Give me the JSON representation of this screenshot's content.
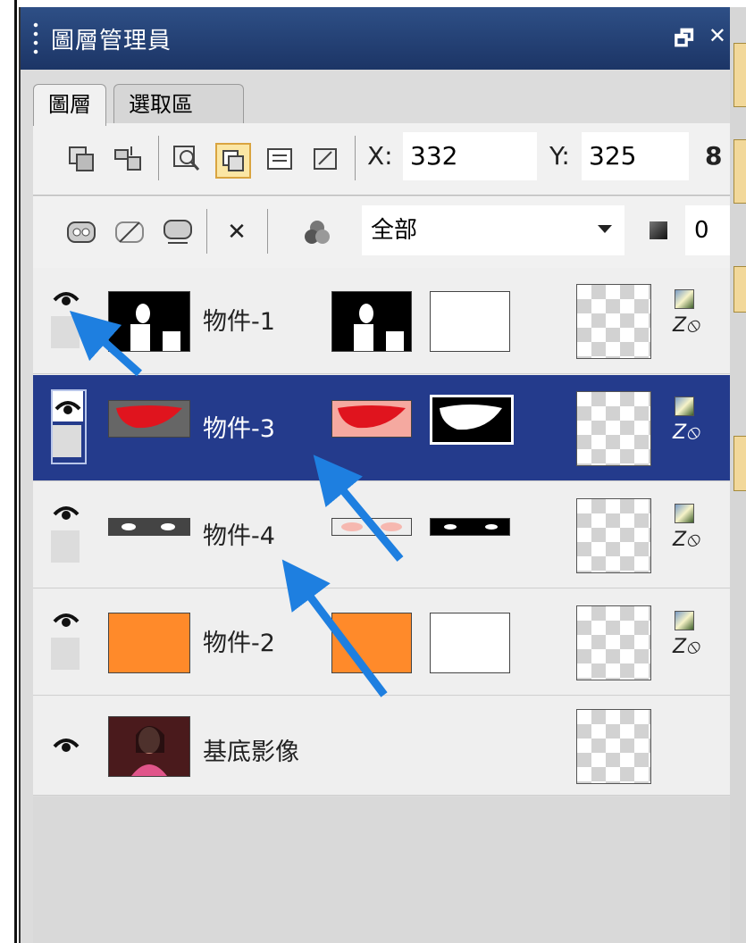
{
  "window": {
    "title": "圖層管理員",
    "restore_glyph": "🗗",
    "close_glyph": "✕"
  },
  "tabs": [
    {
      "label": "圖層"
    },
    {
      "label": "選取區"
    }
  ],
  "toolbar": {
    "x_label": "X:",
    "x_value": "332",
    "y_label": "Y:",
    "y_value": "325",
    "link_glyph": "8",
    "delete_glyph": "✕",
    "channel_dropdown_value": "全部",
    "opacity_value": "0"
  },
  "layers": [
    {
      "name": "物件-1",
      "selected": false,
      "thumb_color": "#000000"
    },
    {
      "name": "物件-3",
      "selected": true,
      "thumb_color": "#666666"
    },
    {
      "name": "物件-4",
      "selected": false,
      "thumb_color": "#444444"
    },
    {
      "name": "物件-2",
      "selected": false,
      "thumb_color": "#ff8a2a"
    },
    {
      "name": "基底影像",
      "selected": false,
      "thumb_color": "#5a1f1f"
    }
  ],
  "colors": {
    "title_bar": "#1c3566",
    "selected_row": "#243b8c",
    "arrow": "#1e7fe0"
  }
}
